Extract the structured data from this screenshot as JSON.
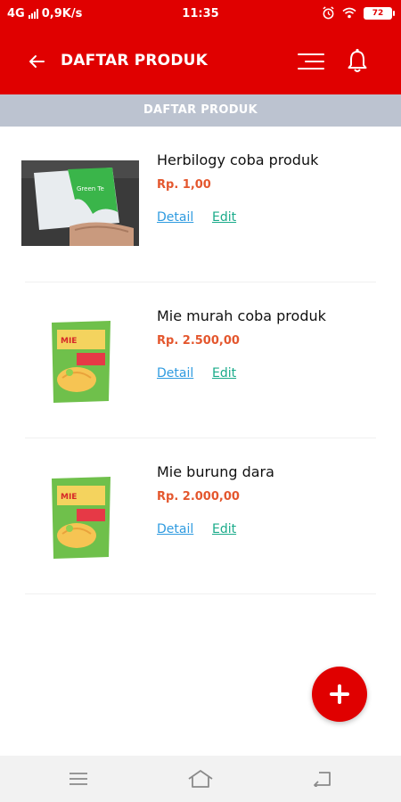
{
  "status_bar": {
    "network": "4G",
    "speed": "0,9K/s",
    "time": "11:35",
    "battery": "72"
  },
  "app_bar": {
    "title": "DAFTAR PRODUK",
    "icons": [
      "back-arrow-icon",
      "menu-icon",
      "bell-icon"
    ]
  },
  "sub_header": {
    "title": "DAFTAR PRODUK"
  },
  "products": [
    {
      "name": "Herbilogy coba produk",
      "price": "Rp. 1,00",
      "detail_label": "Detail",
      "edit_label": "Edit",
      "image": "herbal-package-photo"
    },
    {
      "name": "Mie murah coba produk",
      "price": "Rp. 2.500,00",
      "detail_label": "Detail",
      "edit_label": "Edit",
      "image": "noodle-package-photo"
    },
    {
      "name": "Mie burung dara",
      "price": "Rp. 2.000,00",
      "detail_label": "Detail",
      "edit_label": "Edit",
      "image": "noodle-package-photo"
    }
  ],
  "fab": {
    "icon": "plus-icon"
  },
  "nav_bar": {
    "icons": [
      "recents-icon",
      "home-icon",
      "back-icon"
    ]
  },
  "colors": {
    "primary": "#e00000",
    "sub_header": "#bcc3d0",
    "price": "#e4572e",
    "detail_link": "#2f9be0",
    "edit_link": "#1aab8a"
  }
}
